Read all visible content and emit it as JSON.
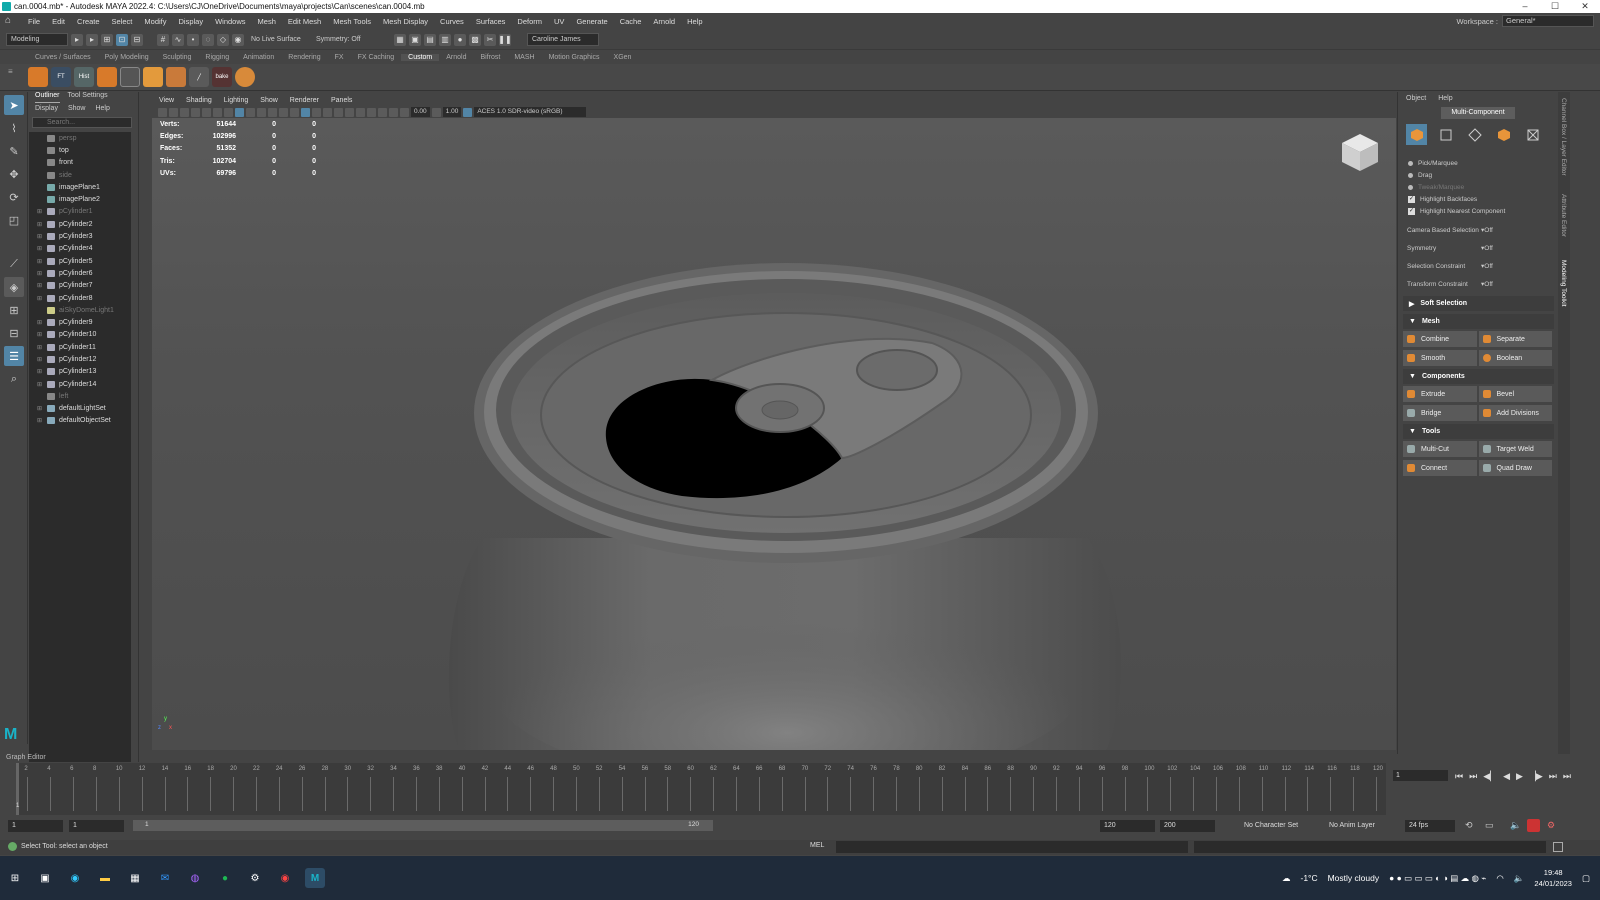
{
  "window": {
    "title": "can.0004.mb* - Autodesk MAYA 2022.4: C:\\Users\\CJ\\OneDrive\\Documents\\maya\\projects\\Can\\scenes\\can.0004.mb",
    "controls": [
      "–",
      "☐",
      "✕"
    ]
  },
  "menubar": {
    "items": [
      "File",
      "Edit",
      "Create",
      "Select",
      "Modify",
      "Display",
      "Windows",
      "Mesh",
      "Edit Mesh",
      "Mesh Tools",
      "Mesh Display",
      "Curves",
      "Surfaces",
      "Deform",
      "UV",
      "Generate",
      "Cache",
      "Arnold",
      "Help"
    ],
    "workspace_label": "Workspace :",
    "workspace_value": "General*"
  },
  "statusline": {
    "menuset": "Modeling",
    "live_surface": "No Live Surface",
    "symmetry": "Symmetry: Off",
    "user": "Caroline James"
  },
  "shelf": {
    "tabs": [
      "Curves / Surfaces",
      "Poly Modeling",
      "Sculpting",
      "Rigging",
      "Animation",
      "Rendering",
      "FX",
      "FX Caching",
      "Custom",
      "Arnold",
      "Bifrost",
      "MASH",
      "Motion Graphics",
      "XGen"
    ],
    "active_tab": "Custom",
    "icon_labels": [
      "FT",
      "Hist",
      "",
      "",
      "",
      "",
      "",
      "",
      "",
      "bake",
      ""
    ]
  },
  "outliner": {
    "tabs": [
      "Outliner",
      "Tool Settings"
    ],
    "menu": [
      "Display",
      "Show",
      "Help"
    ],
    "search_placeholder": "Search...",
    "items": [
      {
        "label": "persp",
        "dim": true,
        "icon": "camera-icon"
      },
      {
        "label": "top",
        "dim": false,
        "icon": "camera-icon"
      },
      {
        "label": "front",
        "dim": false,
        "icon": "camera-icon"
      },
      {
        "label": "side",
        "dim": true,
        "icon": "camera-icon"
      },
      {
        "label": "imagePlane1",
        "dim": false,
        "icon": "image-plane-icon"
      },
      {
        "label": "imagePlane2",
        "dim": false,
        "icon": "image-plane-icon"
      },
      {
        "label": "pCylinder1",
        "dim": true,
        "icon": "mesh-icon"
      },
      {
        "label": "pCylinder2",
        "dim": false,
        "icon": "mesh-icon"
      },
      {
        "label": "pCylinder3",
        "dim": false,
        "icon": "mesh-icon"
      },
      {
        "label": "pCylinder4",
        "dim": false,
        "icon": "mesh-icon"
      },
      {
        "label": "pCylinder5",
        "dim": false,
        "icon": "mesh-icon"
      },
      {
        "label": "pCylinder6",
        "dim": false,
        "icon": "mesh-icon"
      },
      {
        "label": "pCylinder7",
        "dim": false,
        "icon": "mesh-icon"
      },
      {
        "label": "pCylinder8",
        "dim": false,
        "icon": "mesh-icon"
      },
      {
        "label": "aiSkyDomeLight1",
        "dim": true,
        "icon": "light-icon"
      },
      {
        "label": "pCylinder9",
        "dim": false,
        "icon": "mesh-icon"
      },
      {
        "label": "pCylinder10",
        "dim": false,
        "icon": "mesh-icon"
      },
      {
        "label": "pCylinder11",
        "dim": false,
        "icon": "mesh-icon"
      },
      {
        "label": "pCylinder12",
        "dim": false,
        "icon": "mesh-icon"
      },
      {
        "label": "pCylinder13",
        "dim": false,
        "icon": "mesh-icon"
      },
      {
        "label": "pCylinder14",
        "dim": false,
        "icon": "mesh-icon"
      },
      {
        "label": "left",
        "dim": true,
        "icon": "camera-icon"
      },
      {
        "label": "defaultLightSet",
        "dim": false,
        "icon": "set-icon"
      },
      {
        "label": "defaultObjectSet",
        "dim": false,
        "icon": "set-icon"
      }
    ]
  },
  "viewport": {
    "menu": [
      "View",
      "Shading",
      "Lighting",
      "Show",
      "Renderer",
      "Panels"
    ],
    "exposure": "0.00",
    "gamma": "1.00",
    "colorspace": "ACES 1.0 SDR-video (sRGB)",
    "hud": [
      {
        "label": "Verts:",
        "a": "51644",
        "b": "0",
        "c": "0"
      },
      {
        "label": "Edges:",
        "a": "102996",
        "b": "0",
        "c": "0"
      },
      {
        "label": "Faces:",
        "a": "51352",
        "b": "0",
        "c": "0"
      },
      {
        "label": "Tris:",
        "a": "102704",
        "b": "0",
        "c": "0"
      },
      {
        "label": "UVs:",
        "a": "69796",
        "b": "0",
        "c": "0"
      }
    ],
    "cube_labels": [
      "FRONT",
      "RIGHT"
    ]
  },
  "toolkit": {
    "menu": [
      "Object",
      "Help"
    ],
    "mode": "Multi-Component",
    "pick_options": [
      {
        "label": "Pick/Marquee",
        "type": "radio",
        "dim": false
      },
      {
        "label": "Drag",
        "type": "radio",
        "dim": false
      },
      {
        "label": "Tweak/Marquee",
        "type": "radio",
        "dim": true
      },
      {
        "label": "Highlight Backfaces",
        "type": "check",
        "dim": false
      },
      {
        "label": "Highlight Nearest Component",
        "type": "check",
        "dim": false
      }
    ],
    "options": [
      {
        "label": "Camera Based Selection",
        "value": "Off"
      },
      {
        "label": "Symmetry",
        "value": "Off"
      },
      {
        "label": "Selection Constraint",
        "value": "Off"
      },
      {
        "label": "Transform Constraint",
        "value": "Off"
      }
    ],
    "sections": {
      "soft": "Soft Selection",
      "mesh": "Mesh",
      "components": "Components",
      "tools": "Tools"
    },
    "mesh_buttons": [
      "Combine",
      "Separate",
      "Smooth",
      "Boolean"
    ],
    "component_buttons": [
      "Extrude",
      "Bevel",
      "Bridge",
      "Add Divisions"
    ],
    "tool_buttons": [
      "Multi-Cut",
      "Target Weld",
      "Connect",
      "Quad Draw"
    ],
    "side_tabs": [
      "Channel Box / Layer Editor",
      "Attribute Editor",
      "Modeling Toolkit"
    ]
  },
  "timeline": {
    "panel_label": "Graph Editor",
    "ticks": [
      "2",
      "4",
      "6",
      "8",
      "10",
      "12",
      "14",
      "16",
      "18",
      "20",
      "22",
      "24",
      "26",
      "28",
      "30",
      "32",
      "34",
      "36",
      "38",
      "40",
      "42",
      "44",
      "46",
      "48",
      "50",
      "52",
      "54",
      "56",
      "58",
      "60",
      "62",
      "64",
      "66",
      "68",
      "70",
      "72",
      "74",
      "76",
      "78",
      "80",
      "82",
      "84",
      "86",
      "88",
      "90",
      "92",
      "94",
      "96",
      "98",
      "100",
      "102",
      "104",
      "106",
      "108",
      "110",
      "112",
      "114",
      "116",
      "118",
      "120"
    ],
    "current_frame": "1",
    "cursor_label": "1"
  },
  "range": {
    "start": "1",
    "inner_start": "1",
    "bar_start": "1",
    "bar_end": "120",
    "end": "120",
    "anim_end": "200",
    "character_set": "No Character Set",
    "anim_layer": "No Anim Layer",
    "fps": "24 fps"
  },
  "commandline": {
    "help": "Select Tool: select an object",
    "lang": "MEL"
  },
  "taskbar": {
    "weather_temp": "-1°C",
    "weather_text": "Mostly cloudy",
    "time": "19:48",
    "date": "24/01/2023"
  },
  "colors": {
    "accent": "#5285a6",
    "bg": "#444444"
  }
}
